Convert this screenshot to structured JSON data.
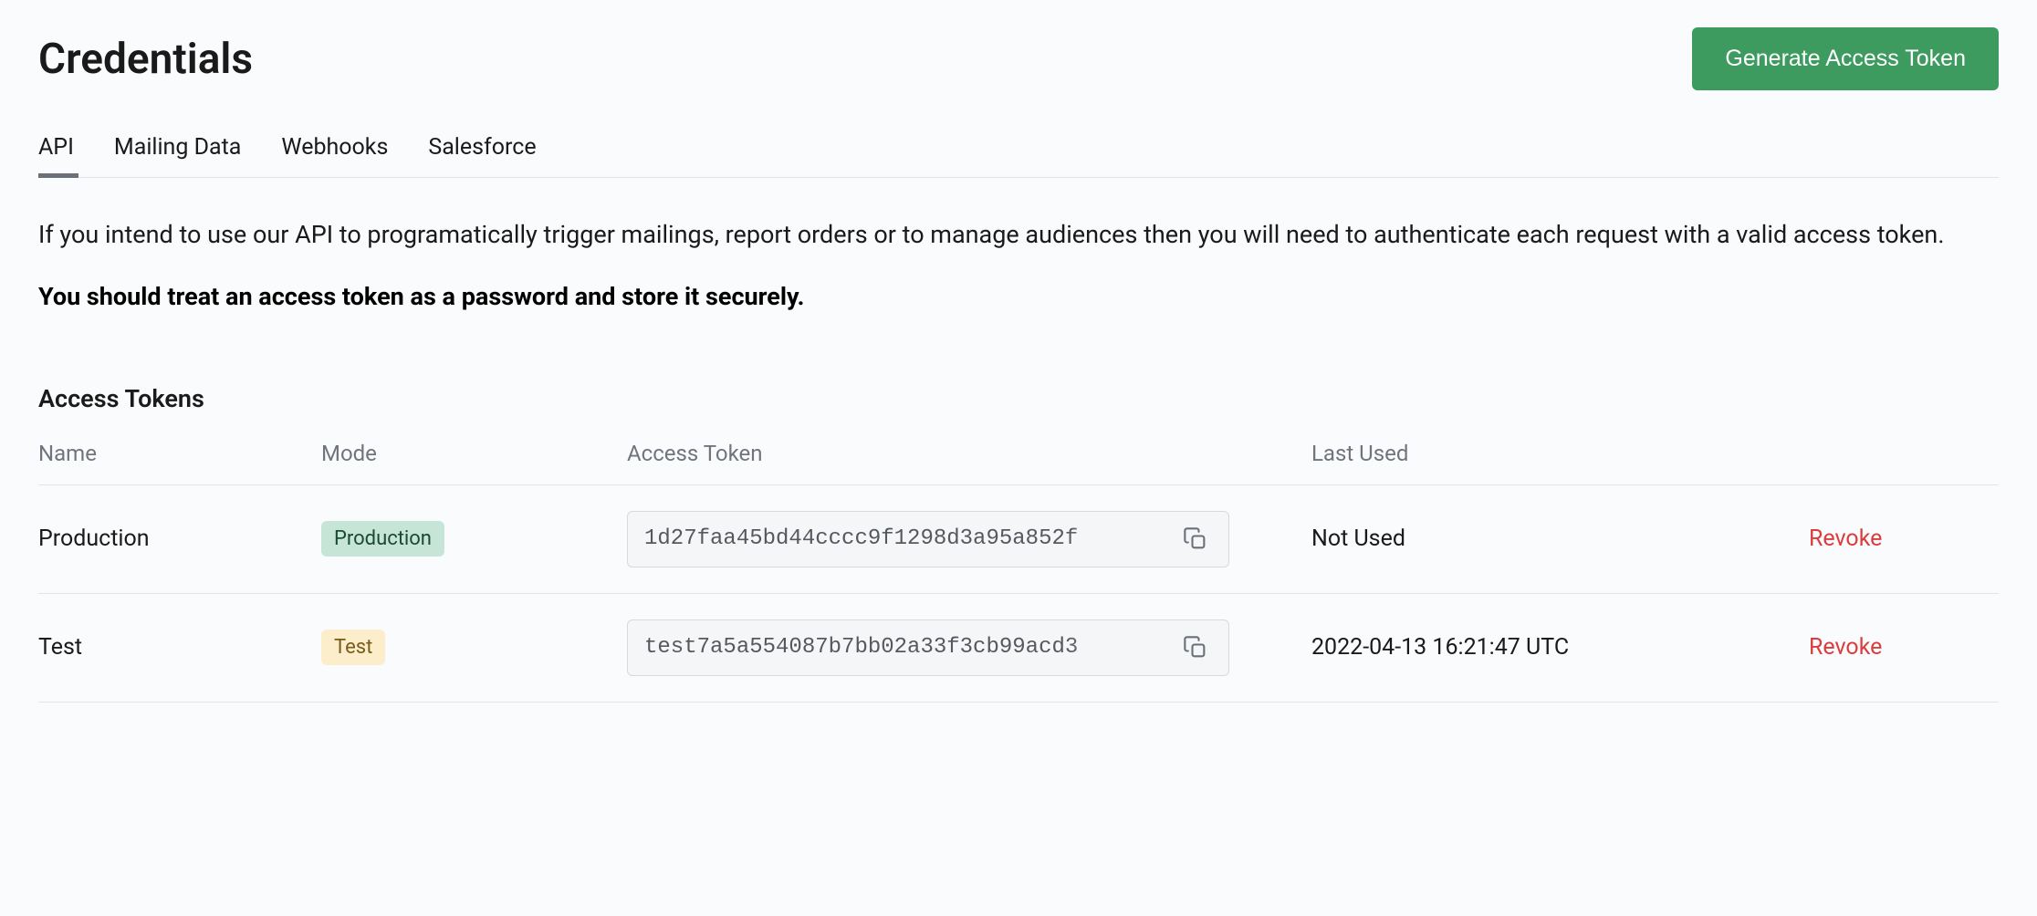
{
  "header": {
    "title": "Credentials",
    "generate_button": "Generate Access Token"
  },
  "tabs": [
    {
      "label": "API",
      "active": true
    },
    {
      "label": "Mailing Data",
      "active": false
    },
    {
      "label": "Webhooks",
      "active": false
    },
    {
      "label": "Salesforce",
      "active": false
    }
  ],
  "intro": "If you intend to use our API to programatically trigger mailings, report orders or to manage audiences then you will need to authenticate each request with a valid access token.",
  "warning": "You should treat an access token as a password and store it securely.",
  "section_title": "Access Tokens",
  "table": {
    "headers": {
      "name": "Name",
      "mode": "Mode",
      "token": "Access Token",
      "last_used": "Last Used"
    },
    "rows": [
      {
        "name": "Production",
        "mode": "Production",
        "mode_variant": "prod",
        "token": "1d27faa45bd44cccc9f1298d3a95a852f",
        "last_used": "Not Used",
        "revoke": "Revoke"
      },
      {
        "name": "Test",
        "mode": "Test",
        "mode_variant": "test",
        "token": "test7a5a554087b7bb02a33f3cb99acd3",
        "last_used": "2022-04-13 16:21:47 UTC",
        "revoke": "Revoke"
      }
    ]
  }
}
